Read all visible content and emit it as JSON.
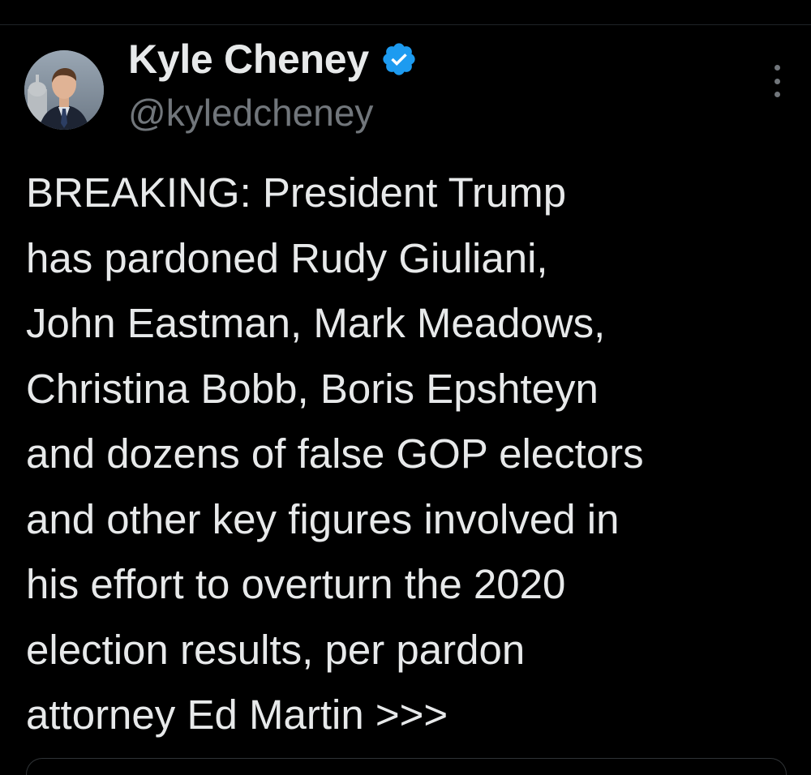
{
  "tweet": {
    "author": {
      "display_name": "Kyle Cheney",
      "handle": "@kyledcheney",
      "verified_icon": "verified-badge-icon",
      "avatar_icon": "profile-photo"
    },
    "more_icon": "more-options-icon",
    "text": "BREAKING: President Trump\nhas pardoned Rudy Giuliani,\nJohn Eastman, Mark Meadows,\nChristina Bobb, Boris Epshteyn\nand dozens of false GOP electors\nand other key figures involved in\nhis effort to overturn the 2020\nelection results, per pardon\nattorney Ed Martin >>>"
  },
  "colors": {
    "background": "#000000",
    "primary_text": "#e7e9ea",
    "secondary_text": "#71767b",
    "verified_blue": "#1d9bf0"
  }
}
